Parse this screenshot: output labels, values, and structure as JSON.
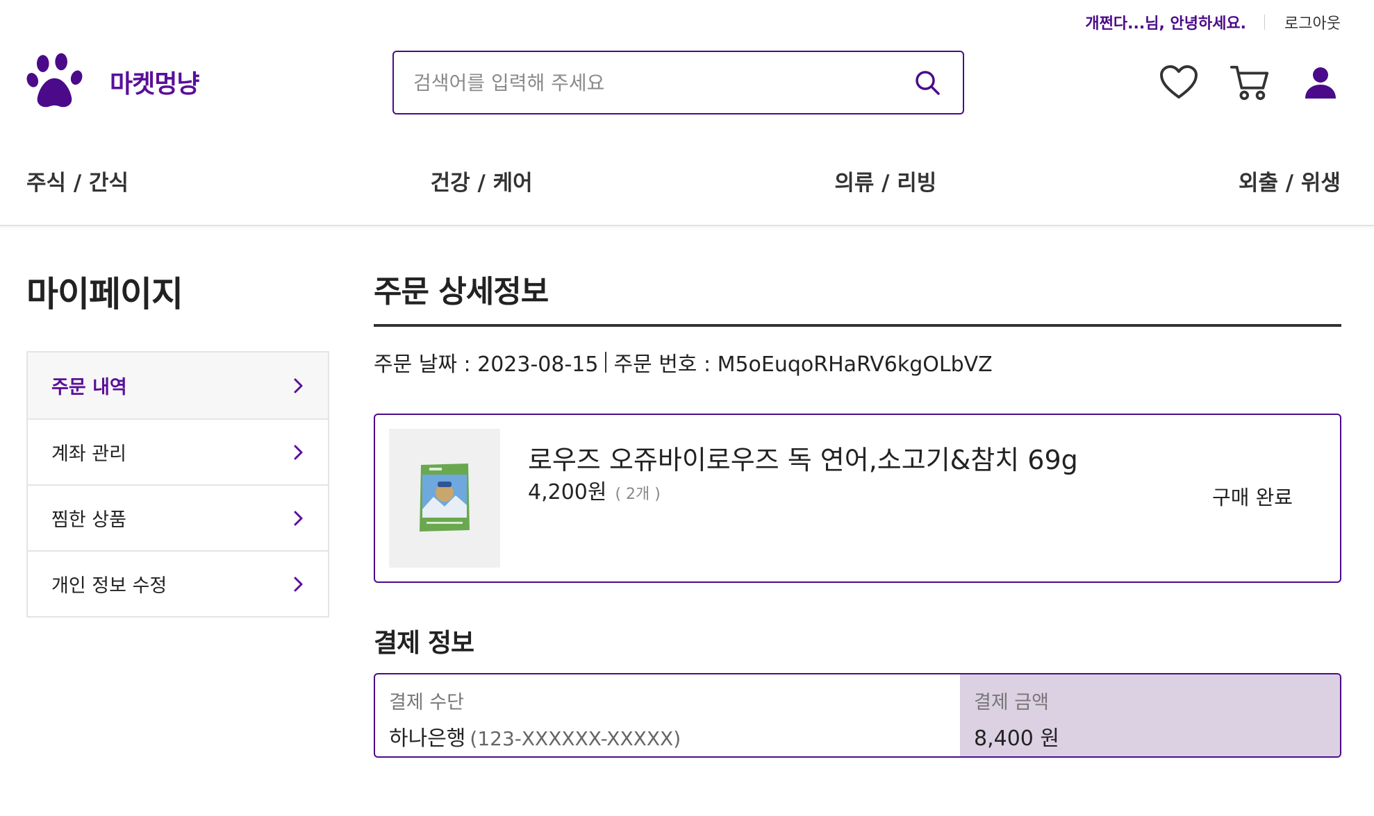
{
  "header": {
    "greeting": "개쩐다...님, 안녕하세요.",
    "logout": "로그아웃",
    "brand": "마켓멍냥",
    "search": {
      "placeholder": "검색어를 입력해 주세요",
      "value": ""
    },
    "icons": [
      "heart-icon",
      "cart-icon",
      "user-icon"
    ]
  },
  "categories": [
    "주식 / 간식",
    "건강 / 케어",
    "의류 / 리빙",
    "외출 / 위생"
  ],
  "sidebar": {
    "title": "마이페이지",
    "items": [
      {
        "label": "주문 내역",
        "active": true
      },
      {
        "label": "계좌 관리",
        "active": false
      },
      {
        "label": "찜한 상품",
        "active": false
      },
      {
        "label": "개인 정보 수정",
        "active": false
      }
    ]
  },
  "order": {
    "title": "주문 상세정보",
    "date_label": "주문 날짜 : 2023-08-15",
    "number_label": "주문 번호 : M5oEuqoRHaRV6kgOLbVZ",
    "product": {
      "name": "로우즈 오쥬바이로우즈 독 연어,소고기&참치 69g",
      "price": "4,200원",
      "quantity": "( 2개 )",
      "status": "구매 완료"
    }
  },
  "payment": {
    "title": "결제 정보",
    "method_label": "결제 수단",
    "method_value": "하나은행",
    "method_account": "(123-XXXXXX-XXXXX)",
    "amount_label": "결제 금액",
    "amount_value": "8,400 원"
  },
  "colors": {
    "brand": "#4b0a8a",
    "brand_text": "#5a0f99",
    "amount_bg": "#dcd0e3",
    "border": "#e4e4e4"
  }
}
